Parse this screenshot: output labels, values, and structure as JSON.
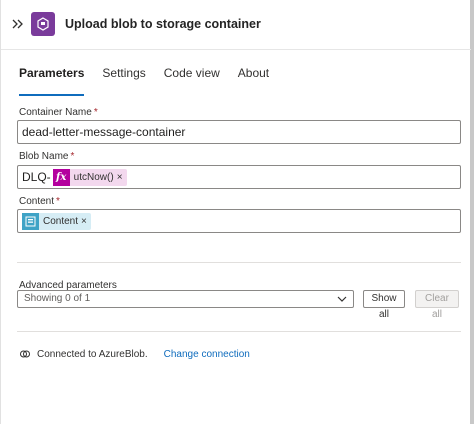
{
  "header": {
    "title": "Upload blob to storage container",
    "collapse_icon": "double-chevron-right-icon",
    "action_icon": "storage-blob-icon",
    "action_color": "#7a3b9b"
  },
  "tabs": [
    {
      "label": "Parameters",
      "active": true
    },
    {
      "label": "Settings",
      "active": false
    },
    {
      "label": "Code view",
      "active": false
    },
    {
      "label": "About",
      "active": false
    }
  ],
  "fields": {
    "container_name": {
      "label": "Container Name",
      "required": "*",
      "value": "dead-letter-message-container"
    },
    "blob_name": {
      "label": "Blob Name",
      "required": "*",
      "prefix": "DLQ-",
      "token_label": "utcNow()",
      "token_remove": "×",
      "token_icon": "function-fx-icon",
      "token_icon_text": "fx",
      "token_color": "#b4009e"
    },
    "content": {
      "label": "Content",
      "required": "*",
      "token_label": "Content",
      "token_remove": "×",
      "token_icon": "content-dynamic-icon",
      "token_color": "#3fa3c6"
    }
  },
  "advanced": {
    "label": "Advanced parameters",
    "select_value": "Showing 0 of 1",
    "show_all": "Show all",
    "clear_all": "Clear all"
  },
  "connection": {
    "text": "Connected to AzureBlob.",
    "change_link": "Change connection",
    "icon": "link-icon"
  }
}
